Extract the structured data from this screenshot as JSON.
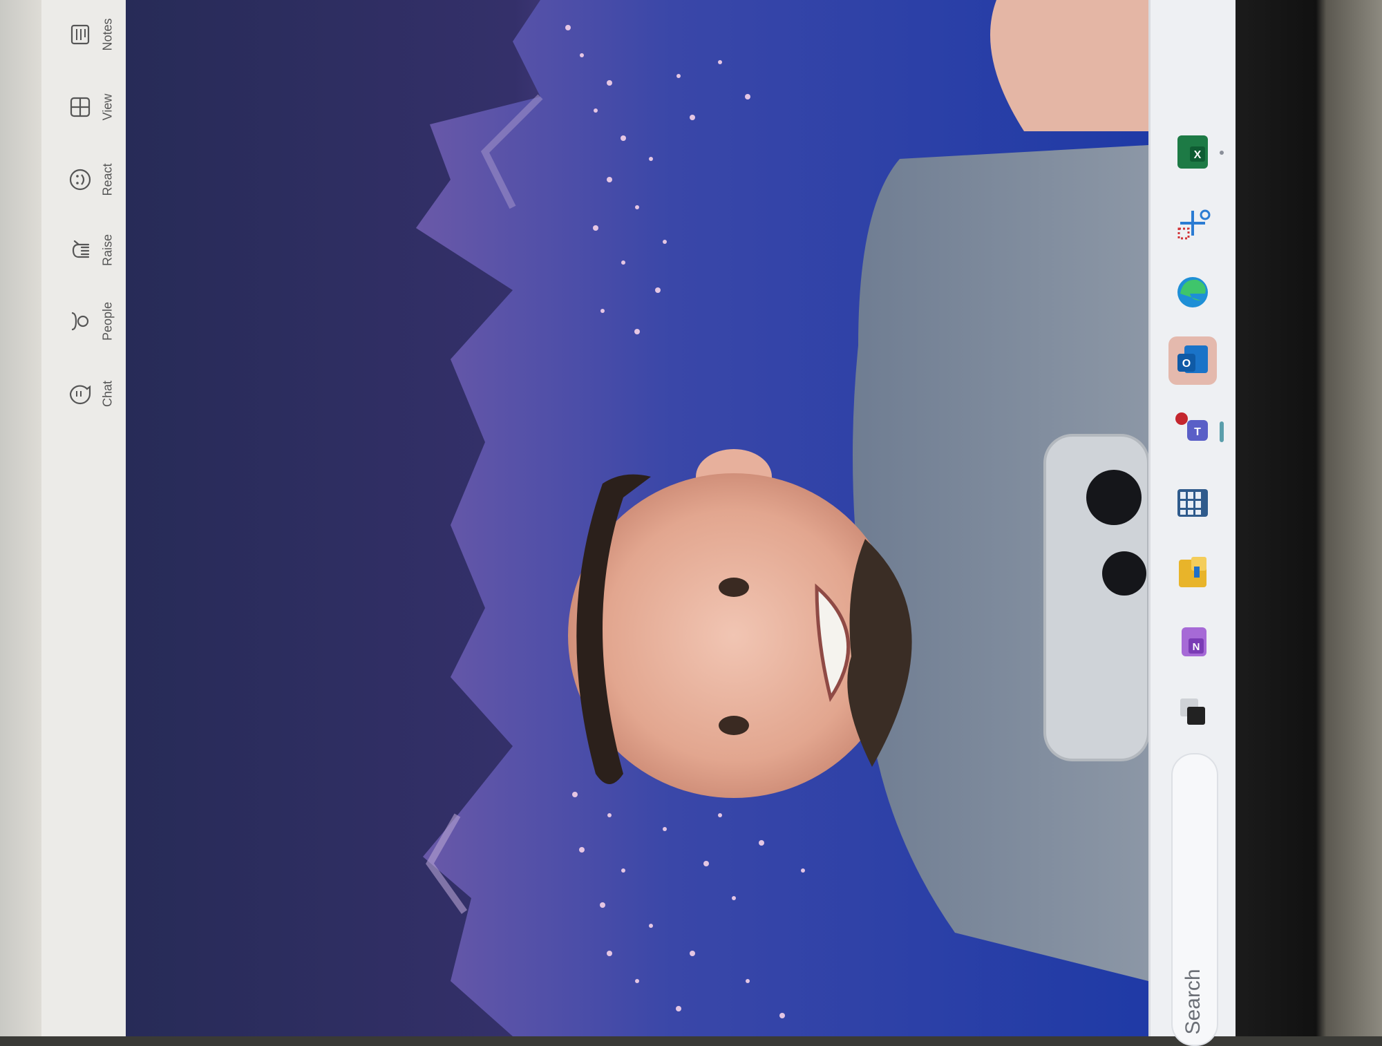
{
  "meeting_toolbar": {
    "items": [
      {
        "id": "chat",
        "label": "Chat",
        "icon": "chat-icon"
      },
      {
        "id": "people",
        "label": "People",
        "icon": "people-icon"
      },
      {
        "id": "raise",
        "label": "Raise",
        "icon": "raise-hand-icon"
      },
      {
        "id": "react",
        "label": "React",
        "icon": "smiley-icon"
      },
      {
        "id": "view",
        "label": "View",
        "icon": "grid-view-icon"
      },
      {
        "id": "notes",
        "label": "Notes",
        "icon": "notes-icon"
      }
    ]
  },
  "video": {
    "background_scene": "night mountains with city lights",
    "colors": {
      "sky": "#3a3475",
      "mountain": "#4a3f92",
      "lights": "#f3c8e4"
    }
  },
  "taskbar": {
    "apps": [
      {
        "id": "excel",
        "icon": "excel-icon",
        "color": "#1d7a45"
      },
      {
        "id": "snipping-tool",
        "icon": "snipping-tool-icon",
        "color": "#2b7cd3"
      },
      {
        "id": "edge",
        "icon": "edge-icon",
        "color": "#1e8fd6"
      },
      {
        "id": "outlook",
        "icon": "outlook-icon",
        "color": "#1a73c8",
        "active": true
      },
      {
        "id": "teams",
        "icon": "teams-icon",
        "color": "#5a5fc7"
      },
      {
        "id": "calculator",
        "icon": "calculator-icon",
        "color": "#2f5b8c"
      },
      {
        "id": "file-explorer",
        "icon": "folder-icon",
        "color": "#e8b42a"
      },
      {
        "id": "onenote",
        "icon": "onenote-icon",
        "color": "#7a3bb5"
      },
      {
        "id": "task-view",
        "icon": "task-view-icon",
        "color": "#222222"
      }
    ],
    "search_label": "Search"
  }
}
